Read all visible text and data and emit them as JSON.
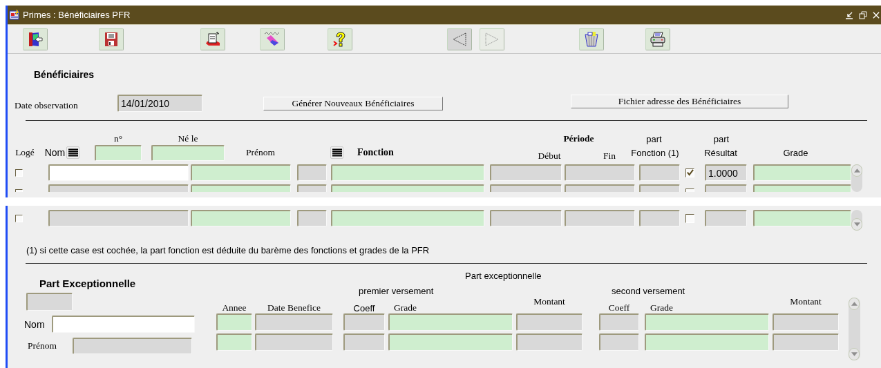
{
  "window": {
    "title": "Primes : Bénéficiaires PFR"
  },
  "toolbar": [
    {
      "kind": "exit"
    },
    {
      "kind": "save"
    },
    {
      "kind": "document"
    },
    {
      "kind": "eraser"
    },
    {
      "kind": "help"
    },
    {
      "kind": "previous"
    },
    {
      "kind": "next"
    },
    {
      "kind": "delete"
    },
    {
      "kind": "print"
    }
  ],
  "beneficiaires": {
    "title": "Bénéficiaires",
    "date_label": "Date observation",
    "date_value": "14/01/2010",
    "buttons": [
      "Générer Nouveaux Bénéficiaires",
      "Fichier adresse des Bénéficiaires"
    ],
    "headers": {
      "numero": "n°",
      "ne_le": "Né le",
      "periode": "Période",
      "part_fonction_top": "part",
      "part_resultat_top": "part",
      "loge": "Logé",
      "nom": "Nom",
      "prenom": "Prénom",
      "fonction": "Fonction",
      "debut": "Début",
      "fin": "Fin",
      "part_fonction": "Fonction (1)",
      "part_resultat": "Résultat",
      "grade": "Grade"
    },
    "rows": [
      {
        "selected": true,
        "loge": false,
        "part_fonction_auto": true,
        "part_resultat": "1.0000"
      },
      {
        "selected": false,
        "loge": false,
        "part_fonction_auto": false
      },
      {
        "selected": false,
        "loge": false,
        "part_fonction_auto": false
      }
    ],
    "footnote": "(1) si cette case est cochée, la part fonction est déduite du barème des fonctions et grades de la PFR"
  },
  "exceptionnelle": {
    "title": "Part Exceptionnelle",
    "nom_label": "Nom",
    "prenom_label": "Prénom",
    "group_title": "Part exceptionnelle",
    "premier": "premier versement",
    "second": "second versement",
    "headers": {
      "annee": "Annee",
      "date_benefice": "Date Benefice",
      "coeff_1": "Coeff",
      "grade_1": "Grade",
      "montant_1": "Montant",
      "coeff_2": "Coeff",
      "grade_2": "Grade",
      "montant_2": "Montant"
    },
    "rows": [
      {
        "kind": "record"
      },
      {
        "kind": "record"
      }
    ]
  }
}
